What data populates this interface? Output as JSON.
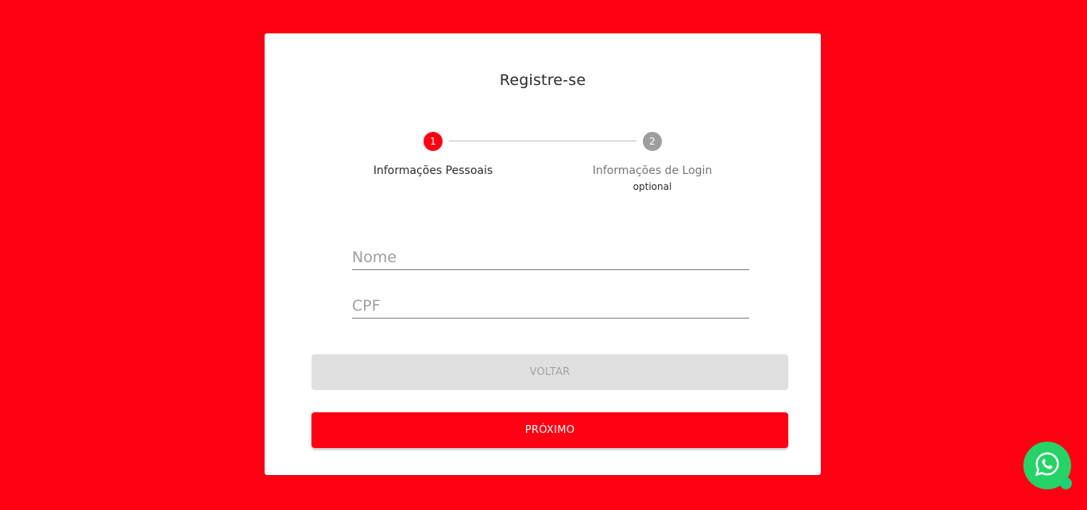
{
  "page": {
    "background_color": "#ff0013"
  },
  "card": {
    "title": "Registre-se"
  },
  "stepper": {
    "steps": [
      {
        "number": "1",
        "label": "Informações Pessoais",
        "sublabel": "",
        "state": "active",
        "color": "#ff0013"
      },
      {
        "number": "2",
        "label": "Informações de Login",
        "sublabel": "optional",
        "state": "inactive",
        "color": "#9e9e9e"
      }
    ]
  },
  "form": {
    "fields": [
      {
        "name": "nome",
        "placeholder": "Nome",
        "value": ""
      },
      {
        "name": "cpf",
        "placeholder": "CPF",
        "value": ""
      }
    ]
  },
  "buttons": {
    "back_label": "VOLTAR",
    "next_label": "PRÓXIMO"
  },
  "whatsapp": {
    "icon": "whatsapp-icon",
    "color": "#25d366"
  }
}
